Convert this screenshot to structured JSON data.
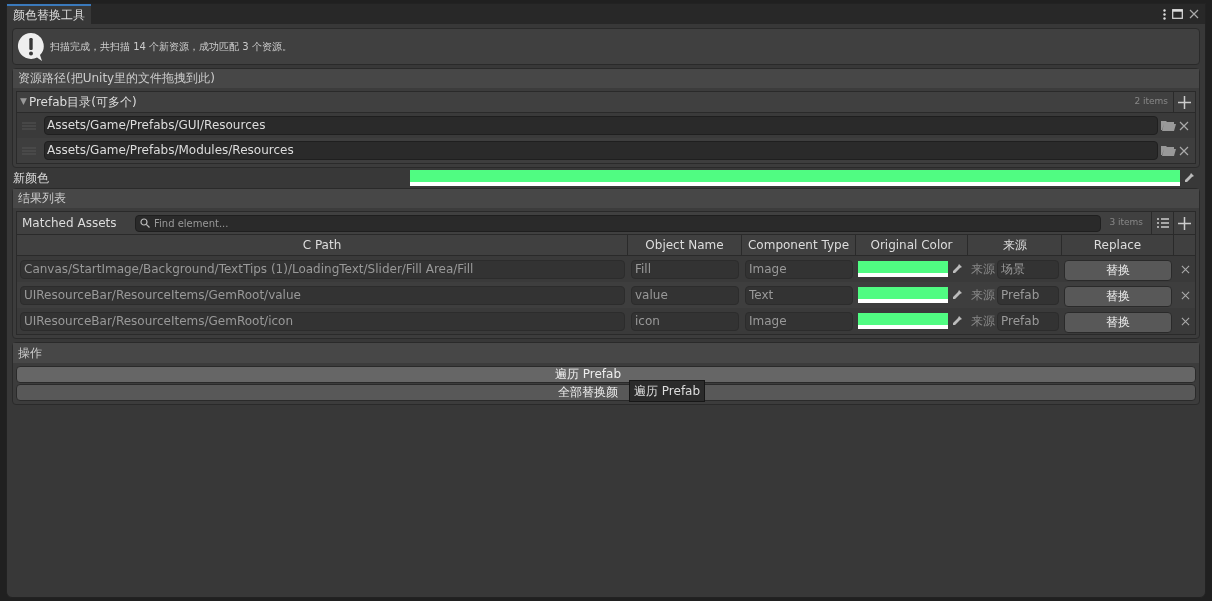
{
  "window": {
    "tab": "颜色替换工具"
  },
  "message": "扫描完成，共扫描 14 个新资源，成功匹配 3 个资源。",
  "path_section": {
    "title": "资源路径(把Unity里的文件拖拽到此)",
    "list": {
      "arrow": "▼",
      "title": "Prefab目录(可多个)",
      "expanded": true,
      "count": "2 items",
      "items": [
        "Assets/Game/Prefabs/GUI/Resources",
        "Assets/Game/Prefabs/Modules/Resources"
      ]
    }
  },
  "new_color": {
    "label": "新颜色",
    "color": "#50fc82"
  },
  "results": {
    "title": "结果列表",
    "list_title": "Matched Assets",
    "search": {
      "placeholder": "Find element..."
    },
    "count": "3 items",
    "columns": [
      "C Path",
      "Object Name",
      "Component Type",
      "Original Color",
      "来源",
      "Replace"
    ],
    "rows": [
      {
        "path": "Canvas/StartImage/Background/TextTips (1)/LoadingText/Slider/Fill Area/Fill",
        "object": "Fill",
        "component": "Image",
        "color": "#50fc82",
        "source_label": "来源",
        "source": "场景",
        "button": "替换"
      },
      {
        "path": "UIResourceBar/ResourceItems/GemRoot/value",
        "object": "value",
        "component": "Text",
        "color": "#50fc82",
        "source_label": "来源",
        "source": "Prefab",
        "button": "替换"
      },
      {
        "path": "UIResourceBar/ResourceItems/GemRoot/icon",
        "object": "icon",
        "component": "Image",
        "color": "#50fc82",
        "source_label": "来源",
        "source": "Prefab",
        "button": "替换"
      }
    ]
  },
  "actions": {
    "title": "操作",
    "buttons": [
      {
        "label": "遍历 Prefab",
        "hovered": true
      },
      {
        "label": "全部替换颜",
        "hovered": false
      }
    ],
    "tooltip": "遍历 Prefab"
  }
}
